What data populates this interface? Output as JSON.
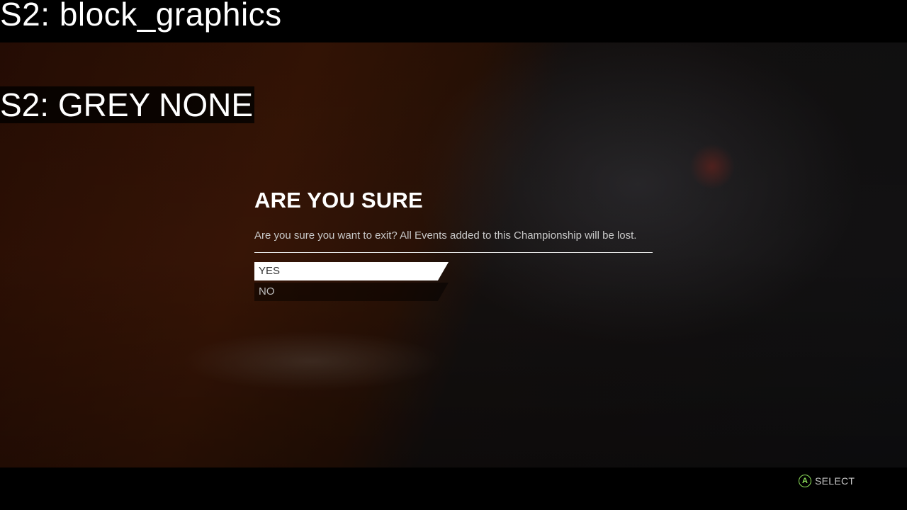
{
  "debug": {
    "line1": "S2: block_graphics",
    "line2": "S2: GREY NONE"
  },
  "dialog": {
    "title": "ARE YOU SURE",
    "message": "Are you sure you want to exit? All Events added to this Championship will be lost.",
    "options": [
      {
        "label": "YES",
        "selected": true
      },
      {
        "label": "NO",
        "selected": false
      }
    ]
  },
  "footer": {
    "button_glyph": "A",
    "button_icon": "gamepad-a-icon",
    "action_label": "SELECT",
    "button_color": "#8de05a"
  }
}
